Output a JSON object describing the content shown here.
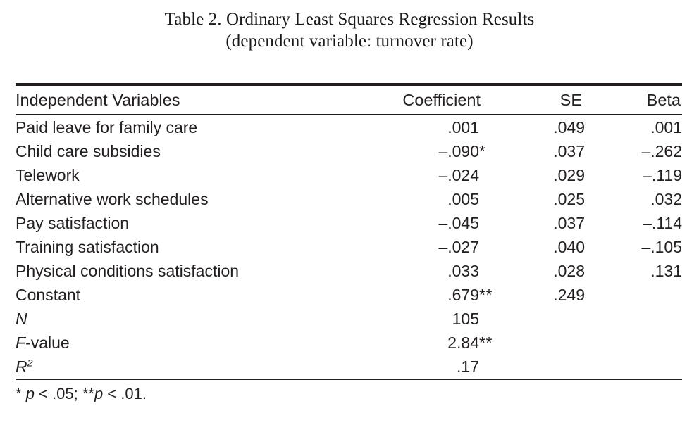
{
  "title": {
    "line1": "Table 2. Ordinary Least Squares Regression Results",
    "line2": "(dependent variable: turnover rate)"
  },
  "table": {
    "columns": {
      "variables": "Independent Variables",
      "coefficient": "Coefficient",
      "se": "SE",
      "beta": "Beta"
    },
    "rows": [
      {
        "label": "Paid leave for family care",
        "coefficient": ".001",
        "coefficient_stars": "",
        "se": ".049",
        "beta": ".001"
      },
      {
        "label": "Child care subsidies",
        "coefficient": "–.090",
        "coefficient_stars": "*",
        "se": ".037",
        "beta": "–.262"
      },
      {
        "label": "Telework",
        "coefficient": "–.024",
        "coefficient_stars": "",
        "se": ".029",
        "beta": "–.119"
      },
      {
        "label": "Alternative work schedules",
        "coefficient": ".005",
        "coefficient_stars": "",
        "se": ".025",
        "beta": ".032"
      },
      {
        "label": "Pay satisfaction",
        "coefficient": "–.045",
        "coefficient_stars": "",
        "se": ".037",
        "beta": "–.114"
      },
      {
        "label": "Training satisfaction",
        "coefficient": "–.027",
        "coefficient_stars": "",
        "se": ".040",
        "beta": "–.105"
      },
      {
        "label": "Physical conditions satisfaction",
        "coefficient": ".033",
        "coefficient_stars": "",
        "se": ".028",
        "beta": ".131"
      },
      {
        "label": "Constant",
        "coefficient": ".679",
        "coefficient_stars": "**",
        "se": ".249",
        "beta": ""
      }
    ],
    "statistics": [
      {
        "symbol": "N",
        "symbol_suffix": "",
        "superscript": "",
        "value": "105",
        "value_stars": ""
      },
      {
        "symbol": "F",
        "symbol_suffix": "-value",
        "superscript": "",
        "value": "2.84",
        "value_stars": "**"
      },
      {
        "symbol": "R",
        "symbol_suffix": "",
        "superscript": "2",
        "value": ".17",
        "value_stars": ""
      }
    ]
  },
  "footnote": {
    "star1": "* ",
    "p1": "p",
    "rest1": " < .05; ",
    "star2": "**",
    "p2": "p",
    "rest2": " < .01."
  }
}
